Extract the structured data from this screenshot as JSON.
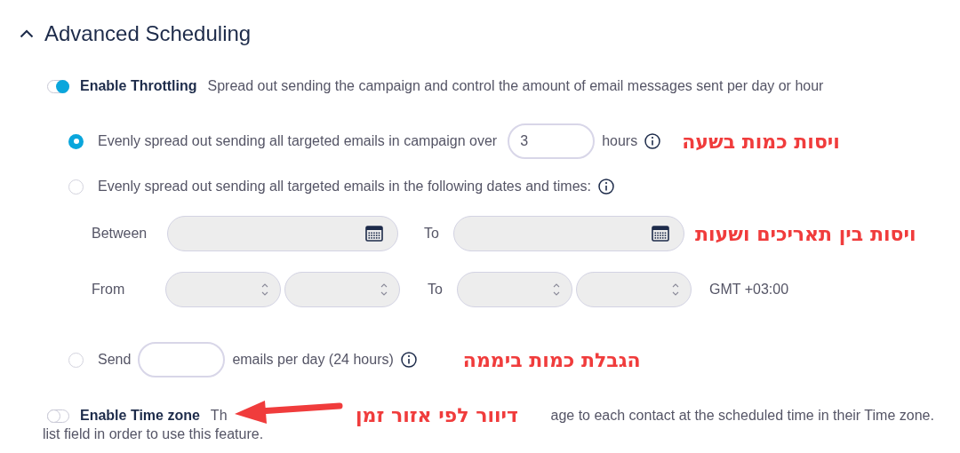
{
  "section": {
    "title": "Advanced Scheduling",
    "expanded": true
  },
  "throttling": {
    "label": "Enable Throttling",
    "on": true,
    "description": "Spread out sending the campaign and control the amount of email messages sent per day or hour"
  },
  "option_hours": {
    "selected": true,
    "label": "Evenly spread out sending all targeted emails in campaign over",
    "value": "3",
    "unit": "hours",
    "note": "ויסות כמות בשעה"
  },
  "option_dates": {
    "selected": false,
    "label": "Evenly spread out sending all targeted emails in the following dates and times:",
    "between_label": "Between",
    "to_label": "To",
    "from_label": "From",
    "time_to_label": "To",
    "timezone": "GMT +03:00",
    "note": "ויסות בין תאריכים ושעות"
  },
  "option_daily": {
    "selected": false,
    "label_before": "Send",
    "label_after": "emails per day (24 hours)",
    "note": "הגבלת כמות ביממה"
  },
  "time_zone": {
    "label": "Enable Time zone",
    "on": false,
    "description_start": "Th",
    "description_end": "age to each contact at the scheduled time in their Time zone.",
    "description_line2": "list field in order to use this feature.",
    "note": "דיוור לפי אזור זמן"
  }
}
